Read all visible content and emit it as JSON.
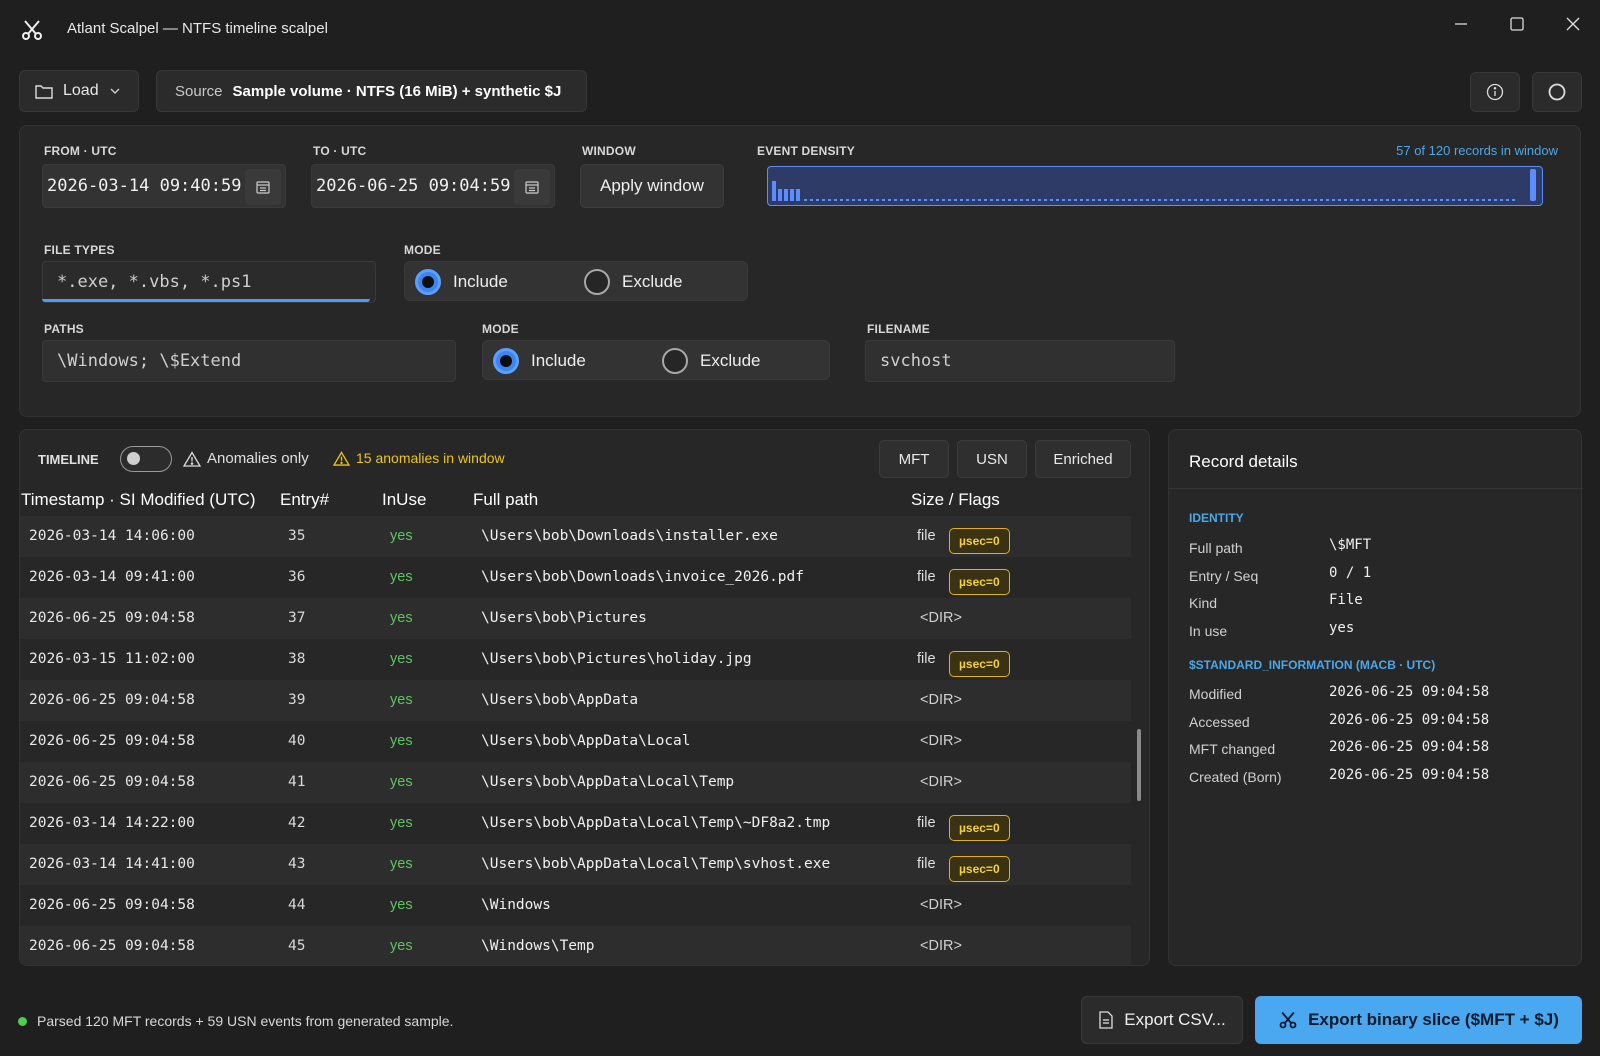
{
  "window": {
    "title": "Atlant Scalpel — NTFS timeline scalpel",
    "icon": "scissors-icon"
  },
  "toolbar": {
    "load_label": "Load",
    "source_label": "Source",
    "source_value": "Sample volume · NTFS (16 MiB) + synthetic $J"
  },
  "filters": {
    "from_label": "FROM · UTC",
    "from_value": "2026-03-14 09:40:59",
    "to_label": "TO · UTC",
    "to_value": "2026-06-25 09:04:59",
    "window_label": "WINDOW",
    "apply_label": "Apply window",
    "density_label": "EVENT DENSITY",
    "density_count": "57 of 120 records in window",
    "file_types_label": "FILE TYPES",
    "file_types_placeholder": "*.exe, *.vbs, *.ps1",
    "mode1_label": "MODE",
    "mode1_selected": "Include",
    "paths_label": "PATHS",
    "paths_placeholder": "\\Windows; \\$Extend",
    "mode2_label": "MODE",
    "mode2_selected": "Include",
    "filename_label": "FILENAME",
    "filename_placeholder": "svchost",
    "include_label": "Include",
    "exclude_label": "Exclude"
  },
  "timeline": {
    "label": "TIMELINE",
    "anomalies_only_label": "Anomalies only",
    "anomalies_only_on": false,
    "anomaly_count_text": "15 anomalies in window",
    "views": [
      "MFT",
      "USN",
      "Enriched"
    ],
    "columns": [
      "Timestamp · SI Modified (UTC)",
      "Entry#",
      "InUse",
      "Full path",
      "Size / Flags"
    ],
    "rows": [
      {
        "ts": "2026-03-14 14:06:00",
        "entry": "35",
        "inuse": "yes",
        "path": "\\Users\\bob\\Downloads\\installer.exe",
        "size": "file",
        "flag": "µsec=0"
      },
      {
        "ts": "2026-03-14 09:41:00",
        "entry": "36",
        "inuse": "yes",
        "path": "\\Users\\bob\\Downloads\\invoice_2026.pdf",
        "size": "file",
        "flag": "µsec=0"
      },
      {
        "ts": "2026-06-25 09:04:58",
        "entry": "37",
        "inuse": "yes",
        "path": "\\Users\\bob\\Pictures",
        "size": "<DIR>",
        "flag": ""
      },
      {
        "ts": "2026-03-15 11:02:00",
        "entry": "38",
        "inuse": "yes",
        "path": "\\Users\\bob\\Pictures\\holiday.jpg",
        "size": "file",
        "flag": "µsec=0"
      },
      {
        "ts": "2026-06-25 09:04:58",
        "entry": "39",
        "inuse": "yes",
        "path": "\\Users\\bob\\AppData",
        "size": "<DIR>",
        "flag": ""
      },
      {
        "ts": "2026-06-25 09:04:58",
        "entry": "40",
        "inuse": "yes",
        "path": "\\Users\\bob\\AppData\\Local",
        "size": "<DIR>",
        "flag": ""
      },
      {
        "ts": "2026-06-25 09:04:58",
        "entry": "41",
        "inuse": "yes",
        "path": "\\Users\\bob\\AppData\\Local\\Temp",
        "size": "<DIR>",
        "flag": ""
      },
      {
        "ts": "2026-03-14 14:22:00",
        "entry": "42",
        "inuse": "yes",
        "path": "\\Users\\bob\\AppData\\Local\\Temp\\~DF8a2.tmp",
        "size": "file",
        "flag": "µsec=0"
      },
      {
        "ts": "2026-03-14 14:41:00",
        "entry": "43",
        "inuse": "yes",
        "path": "\\Users\\bob\\AppData\\Local\\Temp\\svhost.exe",
        "size": "file",
        "flag": "µsec=0"
      },
      {
        "ts": "2026-06-25 09:04:58",
        "entry": "44",
        "inuse": "yes",
        "path": "\\Windows",
        "size": "<DIR>",
        "flag": ""
      },
      {
        "ts": "2026-06-25 09:04:58",
        "entry": "45",
        "inuse": "yes",
        "path": "\\Windows\\Temp",
        "size": "<DIR>",
        "flag": ""
      }
    ]
  },
  "details": {
    "title": "Record details",
    "identity_head": "IDENTITY",
    "identity": [
      {
        "k": "Full path",
        "v": "\\$MFT"
      },
      {
        "k": "Entry / Seq",
        "v": "0 / 1"
      },
      {
        "k": "Kind",
        "v": "File"
      },
      {
        "k": "In use",
        "v": "yes"
      }
    ],
    "si_head": "$STANDARD_INFORMATION (MACB · UTC)",
    "si": [
      {
        "k": "Modified",
        "v": "2026-06-25 09:04:58"
      },
      {
        "k": "Accessed",
        "v": "2026-06-25 09:04:58"
      },
      {
        "k": "MFT changed",
        "v": "2026-06-25 09:04:58"
      },
      {
        "k": "Created (Born)",
        "v": "2026-06-25 09:04:58"
      }
    ]
  },
  "status": {
    "text": "Parsed 120 MFT records + 59 USN events from generated sample."
  },
  "actions": {
    "export_csv_label": "Export CSV...",
    "export_binary_label": "Export binary slice ($MFT + $J)"
  },
  "colors": {
    "accent": "#4aa8f0",
    "anomaly": "#f0c419",
    "inuse_yes": "#5fc35f",
    "density_bar": "#5b8dff"
  }
}
